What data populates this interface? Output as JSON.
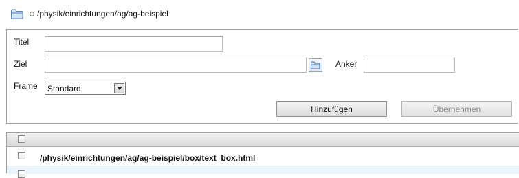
{
  "breadcrumb": {
    "path": "/physik/einrichtungen/ag/ag-beispiel"
  },
  "form": {
    "titel_label": "Titel",
    "titel_value": "",
    "ziel_label": "Ziel",
    "ziel_value": "",
    "anker_label": "Anker",
    "anker_value": "",
    "frame_label": "Frame",
    "frame_selected": "Standard",
    "add_button": "Hinzufügen",
    "apply_button": "Übernehmen"
  },
  "list": {
    "rows": [
      {
        "path": "/physik/einrichtungen/ag/ag-beispiel/box/text_box.html"
      }
    ]
  },
  "colors": {
    "folder": "#6f9ed3",
    "selected_row": "#e9f4fb"
  }
}
